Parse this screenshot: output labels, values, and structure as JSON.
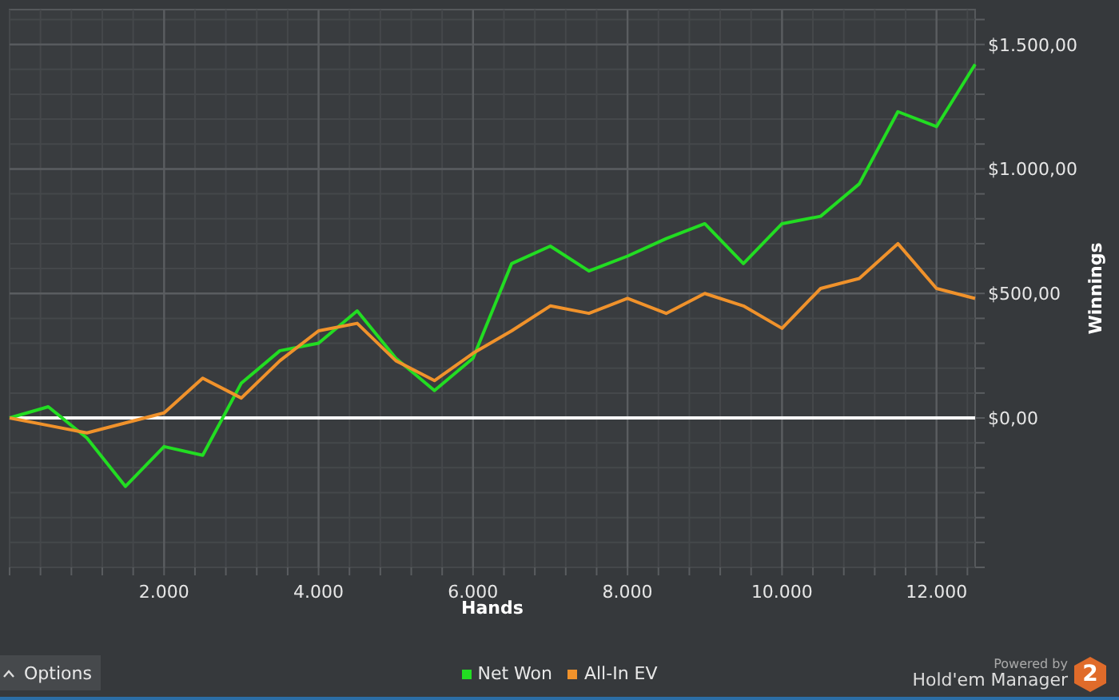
{
  "chart": {
    "chart_data": {
      "type": "line",
      "xlabel": "Hands",
      "ylabel": "Winnings",
      "x": [
        0,
        500,
        1000,
        1500,
        2000,
        2500,
        3000,
        3500,
        4000,
        4500,
        5000,
        5500,
        6000,
        6500,
        7000,
        7500,
        8000,
        8500,
        9000,
        9500,
        10000,
        10500,
        11000,
        11500,
        12000,
        12500
      ],
      "series": [
        {
          "name": "Net Won",
          "color": "#22dd22",
          "values": [
            0,
            45,
            -80,
            -275,
            -115,
            -150,
            140,
            270,
            300,
            430,
            240,
            110,
            240,
            620,
            690,
            590,
            650,
            720,
            780,
            620,
            780,
            810,
            940,
            1230,
            1170,
            1420
          ]
        },
        {
          "name": "All-In EV",
          "color": "#f0922b",
          "values": [
            0,
            -30,
            -60,
            -20,
            20,
            160,
            80,
            230,
            350,
            380,
            230,
            150,
            260,
            350,
            450,
            420,
            480,
            420,
            500,
            450,
            360,
            520,
            560,
            700,
            520,
            480
          ]
        }
      ],
      "grid": true,
      "xlim": [
        0,
        12500
      ],
      "ylim": [
        -600,
        1640
      ],
      "xticks": [
        {
          "value": 2000,
          "label": "2.000"
        },
        {
          "value": 4000,
          "label": "4.000"
        },
        {
          "value": 6000,
          "label": "6.000"
        },
        {
          "value": 8000,
          "label": "8.000"
        },
        {
          "value": 10000,
          "label": "10.000"
        },
        {
          "value": 12000,
          "label": "12.000"
        }
      ],
      "yticks": [
        {
          "value": 0,
          "label": "$0,00"
        },
        {
          "value": 500,
          "label": "$500,00"
        },
        {
          "value": 1000,
          "label": "$1.000,00"
        },
        {
          "value": 1500,
          "label": "$1.500,00"
        }
      ]
    }
  },
  "footer": {
    "options_button": "Options",
    "brand": {
      "powered_by": "Powered by",
      "name": "Hold'em Manager",
      "badge": "2"
    }
  }
}
